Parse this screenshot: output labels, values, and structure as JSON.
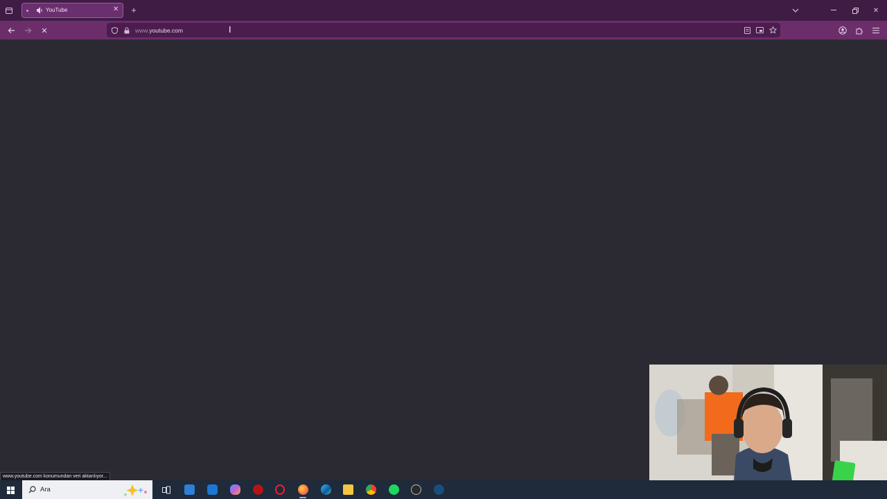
{
  "browser": {
    "tab": {
      "title": "YouTube"
    },
    "new_tab_label": "+",
    "address": {
      "prefix": "www.",
      "domain": "youtube.com"
    }
  },
  "status_bar": {
    "text": "www.youtube.com konumundan veri aktarılıyor..."
  },
  "taskbar": {
    "search_placeholder": "Ara",
    "apps": [
      "task-view",
      "microsoft-store",
      "outlook",
      "copilot",
      "app-red",
      "opera",
      "firefox",
      "edge",
      "file-explorer",
      "chrome",
      "spotify",
      "obs",
      "steam"
    ]
  },
  "colors": {
    "tabstrip": "#3f1c44",
    "navbar": "#6b2e6b",
    "page_bg": "#2b2a33"
  }
}
